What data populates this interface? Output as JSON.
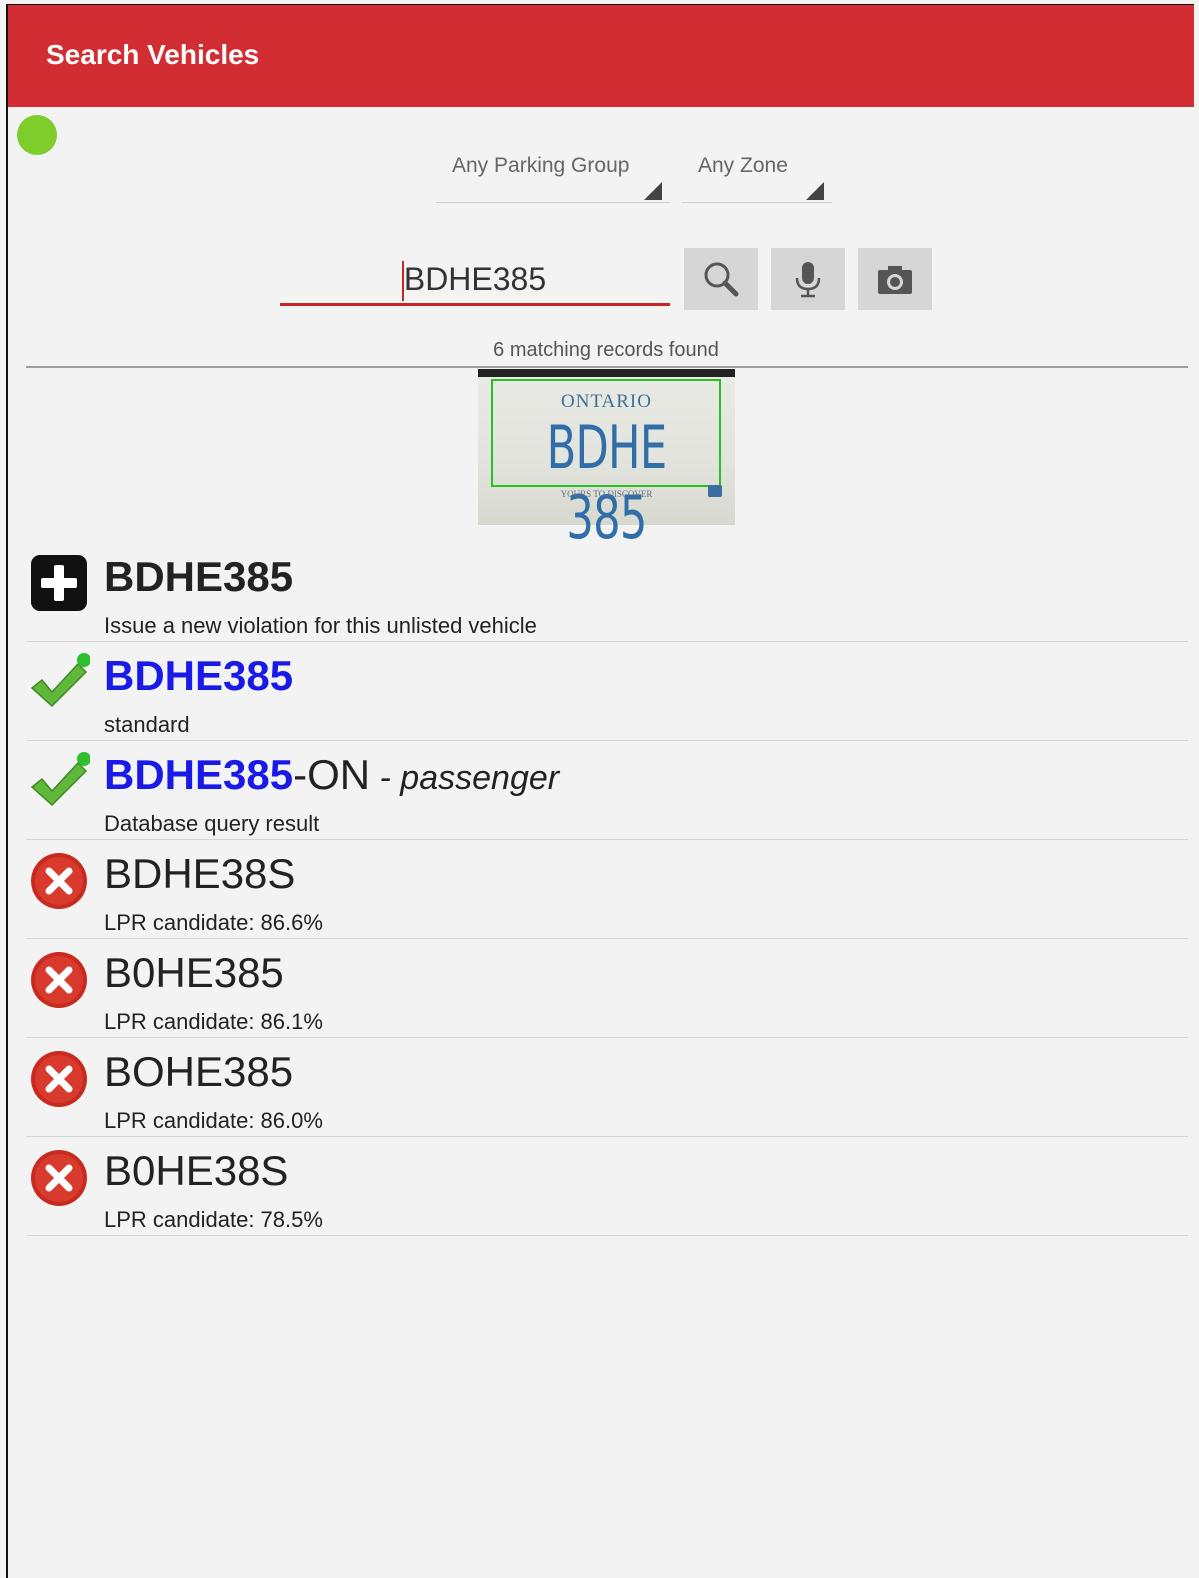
{
  "appbar": {
    "title": "Search Vehicles",
    "color": "#d22d32"
  },
  "status": {
    "color": "#7fcd2b"
  },
  "filters": {
    "parking_group": "Any Parking Group",
    "zone": "Any Zone"
  },
  "search": {
    "value": "BDHE385",
    "buttons": {
      "search": "search-icon",
      "voice": "microphone-icon",
      "camera": "camera-icon"
    }
  },
  "results": {
    "count_text": "6 matching records found"
  },
  "plate_image": {
    "province": "ONTARIO",
    "number": "BDHE 385",
    "slogan": "YOURS TO DISCOVER"
  },
  "list": {
    "new_violation": {
      "title": "BDHE385",
      "subtitle": "Issue a new violation for this unlisted vehicle"
    },
    "match_standard": {
      "title": "BDHE385",
      "subtitle": "standard"
    },
    "match_db": {
      "title": "BDHE385",
      "suffix": "-ON",
      "type": " - passenger",
      "subtitle": "Database query result"
    },
    "candidates": [
      {
        "title": "BDHE38S",
        "subtitle": "LPR candidate: 86.6%"
      },
      {
        "title": "B0HE385",
        "subtitle": "LPR candidate: 86.1%"
      },
      {
        "title": "BOHE385",
        "subtitle": "LPR candidate: 86.0%"
      },
      {
        "title": "B0HE38S",
        "subtitle": "LPR candidate: 78.5%"
      }
    ]
  }
}
